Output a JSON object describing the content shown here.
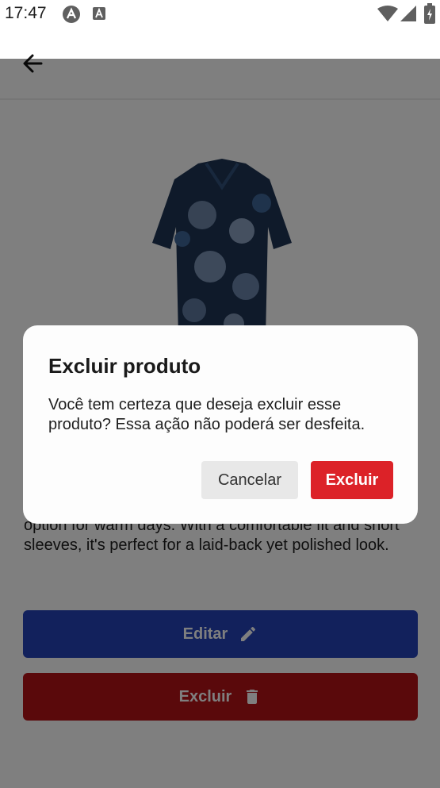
{
  "status_bar": {
    "time": "17:47",
    "icons": [
      "app-notification-icon",
      "text-notification-icon",
      "wifi-icon",
      "cell-signal-icon",
      "battery-icon"
    ]
  },
  "header": {
    "back_icon": "arrow-back-icon"
  },
  "product": {
    "image_icon": "shirt-image",
    "description": "option for warm days. With a comfortable fit and short sleeves, it's perfect for a laid-back yet polished look."
  },
  "actions": {
    "edit_label": "Editar",
    "edit_icon": "pencil-icon",
    "delete_label": "Excluir",
    "delete_icon": "trash-icon"
  },
  "dialog": {
    "title": "Excluir produto",
    "message": "Você tem certeza que deseja excluir esse produto? Essa ação não poderá ser desfeita.",
    "cancel_label": "Cancelar",
    "confirm_label": "Excluir"
  },
  "colors": {
    "edit_button": "#2442b8",
    "delete_button": "#b51217",
    "confirm_button": "#dc2228",
    "cancel_button": "#e8e8e8"
  }
}
